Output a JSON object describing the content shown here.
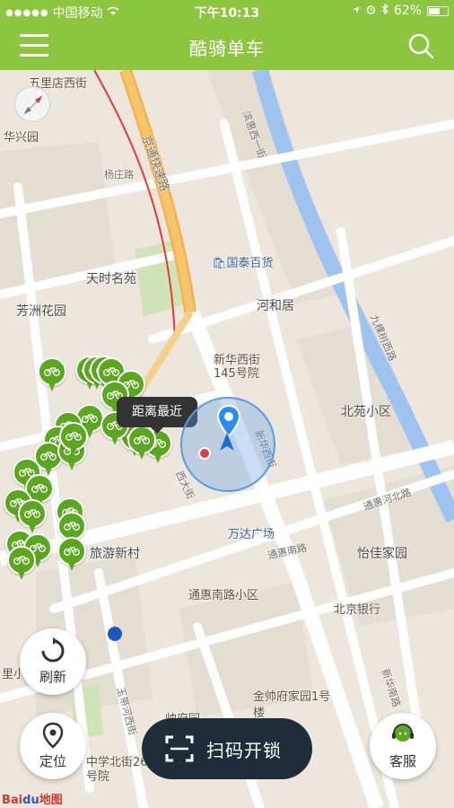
{
  "status_bar": {
    "carrier": "中国移动",
    "time": "下午10:13",
    "battery": "62%",
    "battery_level": 0.62
  },
  "header": {
    "title": "酷骑单车",
    "menu_icon": "hamburger-menu-icon",
    "search_icon": "search-icon"
  },
  "map": {
    "places": [
      "五里店西街",
      "华兴园",
      "杨庄路",
      "天时名苑",
      "芳洲花园",
      "国泰百货",
      "河和居",
      "新华西街145号院",
      "北苑小区",
      "万达广场",
      "旅游新村",
      "怡佳家园",
      "通惠南路小区",
      "北京银行",
      "帅府园",
      "金帅府家园1号楼",
      "里小区",
      "中学北街26号院",
      "西大街"
    ],
    "roads": [
      "京通快速路",
      "通惠南路",
      "通惠河北路",
      "新华南路",
      "新华西街",
      "滨惠西一街",
      "玉带河西街",
      "九棵树西路"
    ],
    "tooltip": "距离最近",
    "brand_prefix": "Bai",
    "brand_middle": "du",
    "brand_suffix": "地图",
    "pin_icon": "bike-pin-icon",
    "accent_color": "#5ba71f"
  },
  "controls": {
    "refresh_label": "刷新",
    "locate_label": "定位",
    "scan_label": "扫码开锁",
    "service_label": "客服"
  }
}
